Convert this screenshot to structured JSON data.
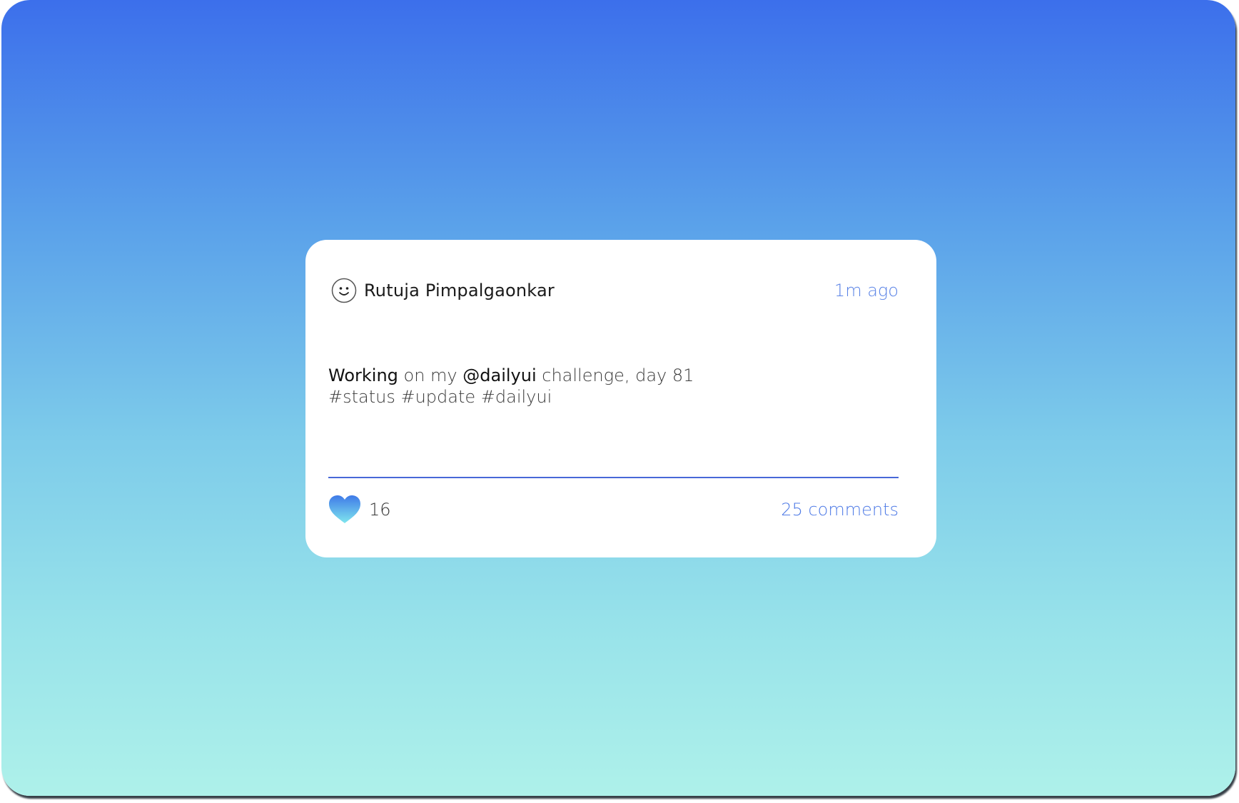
{
  "colors": {
    "gradient_top": "#3c6feb",
    "gradient_bottom": "#aef1ea",
    "accent": "#5a83e6",
    "divider": "#4868d8",
    "heart_top": "#3f7ae8",
    "heart_bottom": "#7fe6ee"
  },
  "post": {
    "author": {
      "name": "Rutuja Pimpalgaonkar",
      "avatar_icon": "smiley-face-icon"
    },
    "timestamp": "1m ago",
    "body": {
      "word1": "Working",
      "text1": " on my ",
      "mention": "@dailyui",
      "text2": " challenge, day 81",
      "hashtags": "#status #update #dailyui"
    },
    "likes": {
      "icon": "heart-icon",
      "count": "16"
    },
    "comments_label": "25 comments"
  }
}
